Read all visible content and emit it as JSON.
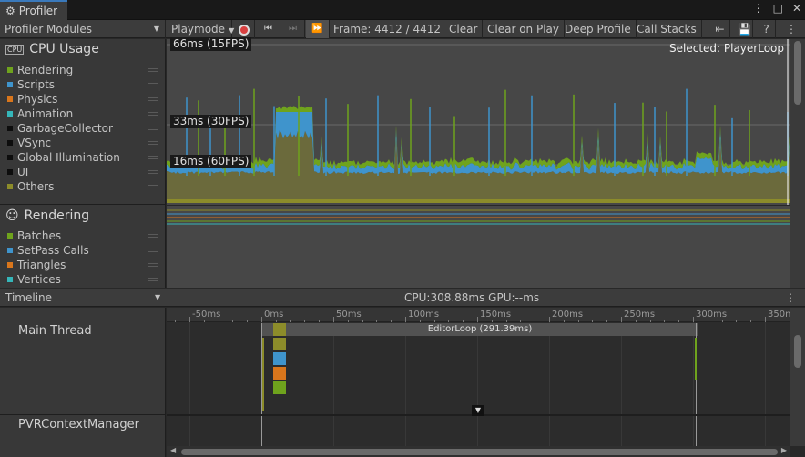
{
  "window": {
    "tab_title": "Profiler"
  },
  "toolbar": {
    "modules_label": "Profiler Modules",
    "playmode_label": "Playmode",
    "frame_label": "Frame: 4412 / 4412",
    "clear_label": "Clear",
    "clear_on_play_label": "Clear on Play",
    "deep_profile_label": "Deep Profile",
    "call_stacks_label": "Call Stacks"
  },
  "cpu_module": {
    "title": "CPU Usage",
    "legend": [
      {
        "label": "Rendering",
        "color": "#6fa31d"
      },
      {
        "label": "Scripts",
        "color": "#3f94cc"
      },
      {
        "label": "Physics",
        "color": "#d9761c"
      },
      {
        "label": "Animation",
        "color": "#35b6b9"
      },
      {
        "label": "GarbageCollector",
        "color": "#0d0d0d"
      },
      {
        "label": "VSync",
        "color": "#0d0d0d"
      },
      {
        "label": "Global Illumination",
        "color": "#0d0d0d"
      },
      {
        "label": "UI",
        "color": "#0d0d0d"
      },
      {
        "label": "Others",
        "color": "#8c8c2a"
      }
    ],
    "fps_lines": [
      "66ms (15FPS)",
      "33ms (30FPS)",
      "16ms (60FPS)"
    ],
    "selected": "Selected: PlayerLoop"
  },
  "rendering_module": {
    "title": "Rendering",
    "legend": [
      {
        "label": "Batches",
        "color": "#6fa31d"
      },
      {
        "label": "SetPass Calls",
        "color": "#3f94cc"
      },
      {
        "label": "Triangles",
        "color": "#d9761c"
      },
      {
        "label": "Vertices",
        "color": "#35b6b9"
      }
    ]
  },
  "timeline": {
    "view_label": "Timeline",
    "cpu_stat": "CPU:308.88ms   GPU:--ms",
    "ticks": [
      "-50ms",
      "0ms",
      "50ms",
      "100ms",
      "150ms",
      "200ms",
      "250ms",
      "300ms",
      "350ms"
    ],
    "main_thread_label": "Main Thread",
    "editor_loop_label": "EditorLoop (291.39ms)",
    "pvr_label": "PVRContextManager"
  }
}
